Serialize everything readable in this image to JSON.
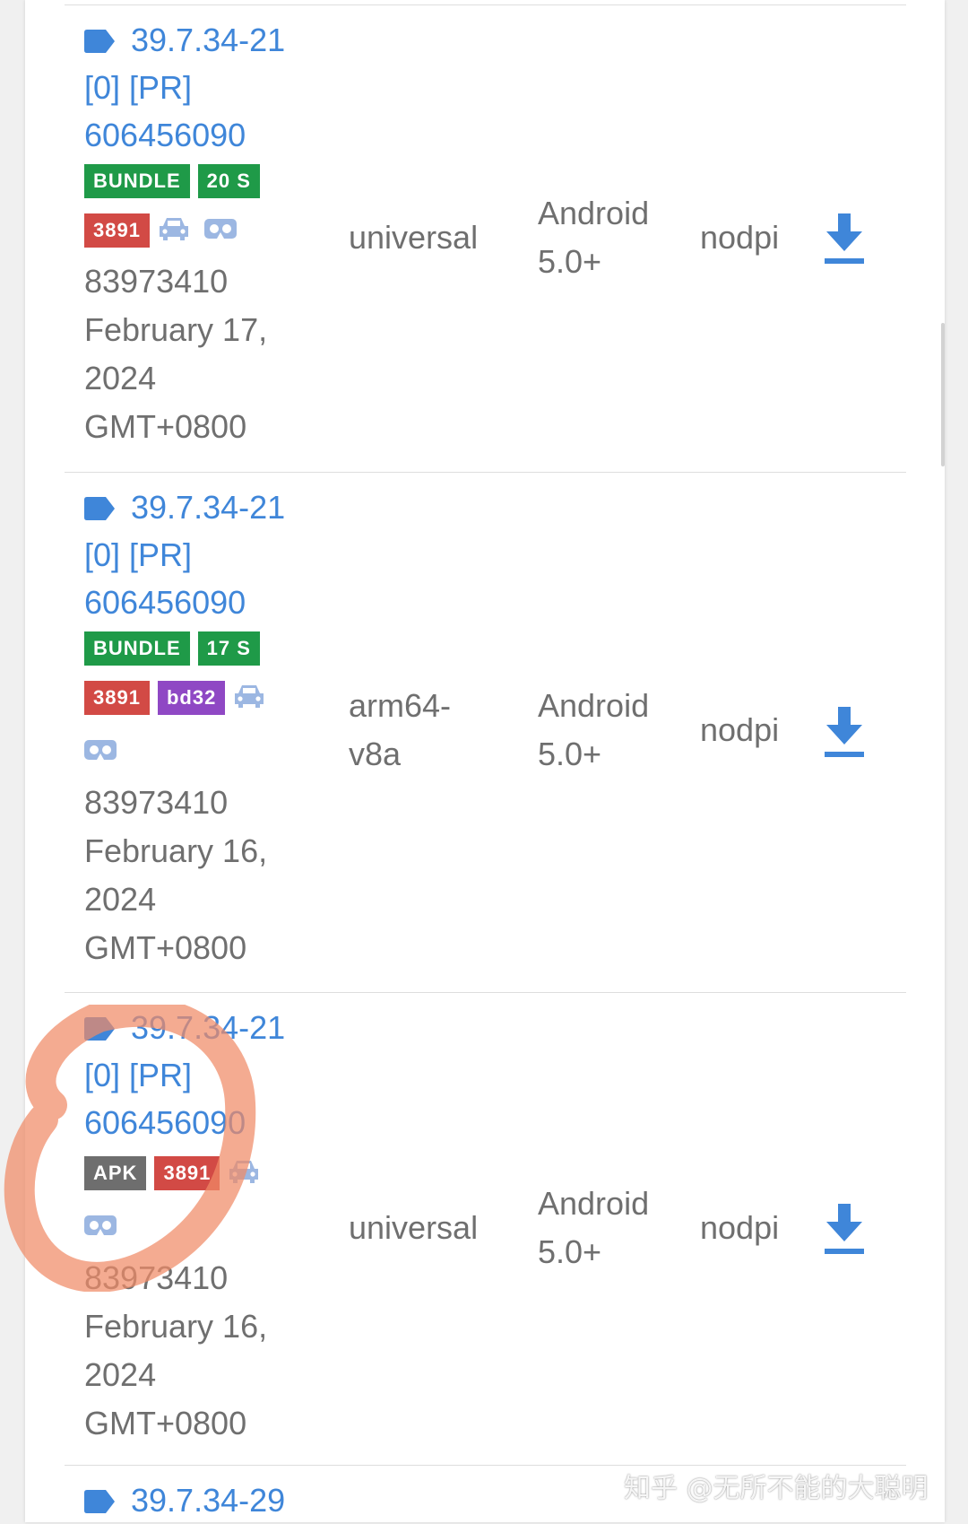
{
  "colors": {
    "link_blue": "#3f86d9",
    "text_gray": "#6f6f6f",
    "badge_green": "#1f9a48",
    "badge_red": "#d24a45",
    "badge_purple": "#8f48c4",
    "badge_gray": "#6e6e6e",
    "icon_light_blue": "#9cb7e2",
    "annotation_orange": "#f08a67"
  },
  "rows": [
    {
      "title_lines": [
        "39.7.34-21",
        "[0] [PR]",
        "606456090"
      ],
      "badges": [
        "BUNDLE",
        "20 S",
        "3891"
      ],
      "icons": [
        "car-icon",
        "vr-headset-icon"
      ],
      "version_code": "83973410",
      "date_lines": [
        "February 17,",
        "2024",
        "GMT+0800"
      ],
      "arch_lines": [
        "universal"
      ],
      "min_api_lines": [
        "Android",
        "5.0+"
      ],
      "dpi": "nodpi"
    },
    {
      "title_lines": [
        "39.7.34-21",
        "[0] [PR]",
        "606456090"
      ],
      "badges": [
        "BUNDLE",
        "17 S",
        "3891",
        "bd32"
      ],
      "icons": [
        "car-icon",
        "vr-headset-icon"
      ],
      "version_code": "83973410",
      "date_lines": [
        "February 16,",
        "2024",
        "GMT+0800"
      ],
      "arch_lines": [
        "arm64-",
        "v8a"
      ],
      "min_api_lines": [
        "Android",
        "5.0+"
      ],
      "dpi": "nodpi"
    },
    {
      "title_lines": [
        "39.7.34-21",
        "[0] [PR]",
        "606456090"
      ],
      "badges": [
        "APK",
        "3891"
      ],
      "icons": [
        "car-icon",
        "vr-headset-icon"
      ],
      "version_code": "83973410",
      "date_lines": [
        "February 16,",
        "2024",
        "GMT+0800"
      ],
      "arch_lines": [
        "universal"
      ],
      "min_api_lines": [
        "Android",
        "5.0+"
      ],
      "dpi": "nodpi"
    },
    {
      "title_lines": [
        "39.7.34-29"
      ]
    }
  ],
  "watermark": "知乎 @无所不能的大聪明"
}
